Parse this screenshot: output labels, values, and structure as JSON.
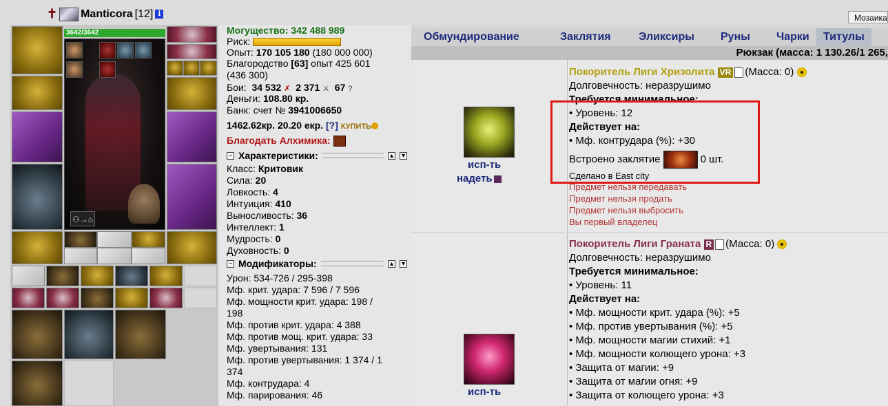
{
  "header": {
    "name": "Manticora",
    "level": "[12]",
    "info_glyph": "i",
    "mosaic_button": "Мозаика"
  },
  "equipment": {
    "hp": "3642/3642"
  },
  "stats": {
    "power_label": "Могущество:",
    "power_value": "342 488 989",
    "risk_label": "Риск:",
    "exp_label": "Опыт:",
    "exp_value": "170 105 180",
    "exp_next": "(180 000 000)",
    "valor_label": "Благородство",
    "valor_level": "[63]",
    "valor_exp": "опыт 425 601",
    "valor_next": "(436 300)",
    "battles_label": "Бои:",
    "battles_wins": "34 532",
    "battles_losses": "2 371",
    "battles_draws": "67",
    "money_label": "Деньги:",
    "money_value": "108.80 кр.",
    "bank_label": "Банк: счет №",
    "bank_account": "3941006650",
    "bank_kr": "1462.62кр.",
    "bank_ekr": "20.20 екр.",
    "bank_help": "[?]",
    "buy_label": "КУПИТЬ",
    "alchemist_label": "Благодать Алхимика:",
    "characteristics_header": "Характеристики:",
    "class_label": "Класс:",
    "class_value": "Критовик",
    "str_label": "Сила:",
    "str_value": "20",
    "agi_label": "Ловкость:",
    "agi_value": "4",
    "int_label": "Интуиция:",
    "int_value": "410",
    "end_label": "Выносливость:",
    "end_value": "36",
    "intel_label": "Интеллект:",
    "intel_value": "1",
    "wis_label": "Мудрость:",
    "wis_value": "0",
    "spir_label": "Духовность:",
    "spir_value": "0",
    "modifiers_header": "Модификаторы:",
    "mods": [
      "Урон: 534-726 / 295-398",
      "Мф. крит. удара: 7 596 / 7 596",
      "Мф. мощности крит. удара: 198 /",
      "198",
      "Мф. против крит. удара: 4 388",
      "Мф. против мощ. крит. удара: 33",
      "Мф. увертывания: 131",
      "Мф. против увертывания: 1 374 / 1",
      "374",
      "Мф. контрудара: 4",
      "Мф. парирования: 46"
    ]
  },
  "tabs": [
    {
      "label": "Обмундирование"
    },
    {
      "label": "Заклятия"
    },
    {
      "label": "Эликсиры"
    },
    {
      "label": "Руны"
    },
    {
      "label": "Чарки"
    },
    {
      "label": "Титулы"
    }
  ],
  "backpack_title": "Рюкзак (масса: 1 130.26/1 265,",
  "items": [
    {
      "name": "Покоритель Лиги Хризолита",
      "badge": "VR",
      "mass": "(Масса: 0)",
      "durability": "Долговечность: неразрушимо",
      "req_header": "Требуется минимальное:",
      "req": "• Уровень: 12",
      "acts_header": "Действует на:",
      "acts": [
        "• Мф. контрудара (%): +30"
      ],
      "embedded_label": "Встроено заклятие",
      "embedded_count": "0 шт.",
      "made_in": "Сделано в East city",
      "notices": [
        "Предмет нельзя передавать",
        "Предмет нельзя продать",
        "Предмет нельзя выбросить",
        "Вы первый владелец"
      ],
      "use_link": "исп-ть",
      "wear_link": "надеть"
    },
    {
      "name": "Покоритель Лиги Граната",
      "badge": "R",
      "mass": "(Масса: 0)",
      "durability": "Долговечность: неразрушимо",
      "req_header": "Требуется минимальное:",
      "req": "• Уровень: 11",
      "acts_header": "Действует на:",
      "acts": [
        "• Мф. мощности крит. удара (%): +5",
        "• Мф. против увертывания (%): +5",
        "• Мф. мощности магии стихий: +1",
        "• Мф. мощности колющего урона: +3",
        "• Защита от магии: +9",
        "• Защита от магии огня: +9",
        "• Защита от колющего урона: +3"
      ],
      "use_link": "исп-ть"
    }
  ]
}
